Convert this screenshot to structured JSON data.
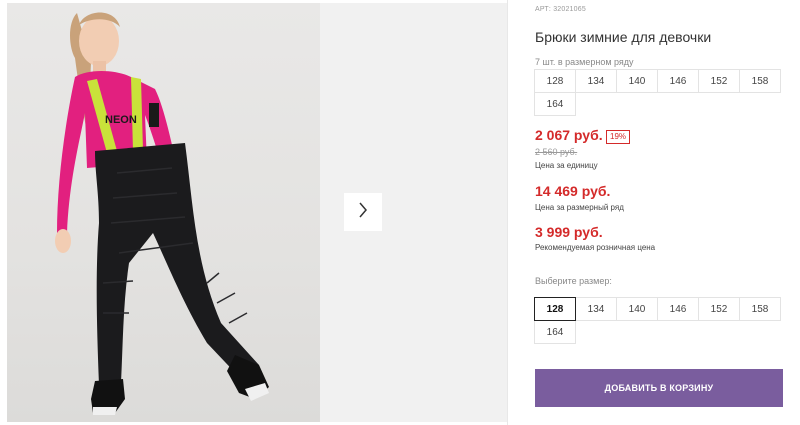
{
  "product": {
    "art": "АРТ: 32021065",
    "title": "Брюки зимние для девочки",
    "pack_label": "7 шт. в размерном ряду",
    "pack_sizes": [
      "128",
      "134",
      "140",
      "146",
      "152",
      "158",
      "164"
    ],
    "price": "2 067 руб.",
    "discount": "19%",
    "old_price": "2 560 руб.",
    "unit_label": "Цена за единицу",
    "row_price": "14 469 руб.",
    "row_label": "Цена за размерный ряд",
    "retail_price": "3 999 руб.",
    "retail_label": "Рекомендуемая розничная цена",
    "choose_label": "Выберите размер:",
    "choose_sizes": [
      "128",
      "134",
      "140",
      "146",
      "152",
      "158",
      "164"
    ],
    "selected_size": "128",
    "add_button": "ДОБАВИТЬ В КОРЗИНУ"
  },
  "gallery": {
    "next_icon": "chevron-right-icon",
    "photo_alt_text": "NEON"
  },
  "colors": {
    "price": "#d42a2a",
    "button": "#7a5d9e"
  }
}
